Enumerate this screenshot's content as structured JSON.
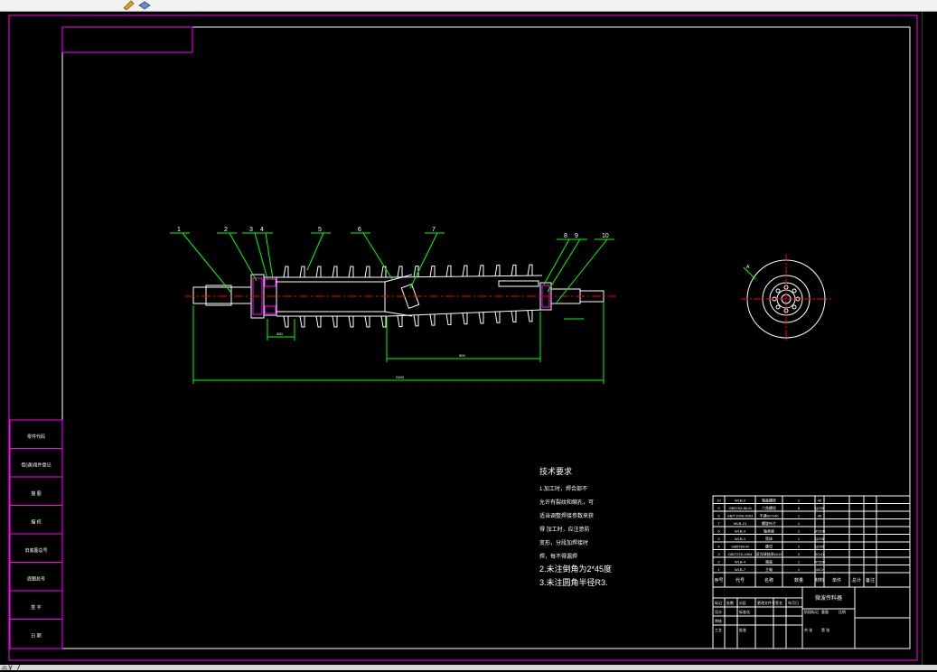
{
  "app": {
    "toolbar_icons": [
      "pencil-icon",
      "layer-icon"
    ],
    "status_text": "三ŷ /"
  },
  "colors": {
    "background": "#000000",
    "frame": "#ff00ff",
    "drawing": "#ffffff",
    "dimension": "#00ff00",
    "centerline": "#ff0000",
    "section": "#ff00ff",
    "text": "#ffffff"
  },
  "drawing": {
    "balloons": [
      "1",
      "2",
      "3",
      "4",
      "5",
      "6",
      "7",
      "8",
      "9",
      "10"
    ],
    "dimensions": [
      "360",
      "2400",
      "900"
    ],
    "section_label": "A",
    "notes_title": "技术要求",
    "notes": [
      "1.加工时，焊合部不",
      "允许有裂纹和缩孔，可",
      "适当调整焊接参数来获",
      "得 加工时，应注意防",
      "变形，分段加焊接时",
      "焊，每不得漏焊",
      "2.未注倒角为2*45度",
      "3.未注圆角半径R3."
    ]
  },
  "left_strip": [
    "零件代码",
    "借(通)用件登记",
    "描 图",
    "描 校",
    "旧底图总号",
    "底图总号",
    "签 字",
    "日 期"
  ],
  "title_block": {
    "drawing_name": "微波传料器",
    "bom_header": [
      "序号",
      "代号",
      "名称",
      "数量",
      "材料",
      "单件",
      "总计",
      "备注"
    ],
    "bom_rows": [
      [
        "10",
        "WLB-2",
        "端盖螺栓",
        "1",
        "45",
        "",
        "",
        ""
      ],
      [
        "9",
        "GB5783-86-M",
        "六角螺栓",
        "8",
        "Q235",
        "",
        "",
        ""
      ],
      [
        "8",
        "GB/T1096-2003",
        "平键8x7x40",
        "1",
        "45",
        "",
        "",
        ""
      ],
      [
        "7",
        "WLB-21",
        "螺旋叶片",
        "1",
        "",
        "",
        "",
        ""
      ],
      [
        "6",
        "WLB-3",
        "轴承座",
        "1",
        "HT200",
        "",
        "",
        ""
      ],
      [
        "5",
        "WLB-1",
        "筒体",
        "1",
        "Q235",
        "",
        "",
        ""
      ],
      [
        "4",
        "GB5783-M",
        "螺母",
        "2",
        "Q235",
        "",
        "",
        ""
      ],
      [
        "3",
        "GB/T276-1994",
        "深沟球轴承6210",
        "2",
        "GCr15",
        "",
        "",
        ""
      ],
      [
        "2",
        "WLB-4",
        "端盖",
        "1",
        "HT150",
        "",
        "",
        ""
      ],
      [
        "1",
        "WLB-7",
        "主轴",
        "1",
        "40Cr",
        "",
        "",
        ""
      ]
    ],
    "sign_row_1": [
      "标记",
      "处数",
      "分区",
      "更改文件号",
      "签名",
      "年月日"
    ],
    "sign_row_2": [
      "设计",
      "",
      "标准化",
      "",
      "阶段标记",
      "重量",
      "比例"
    ],
    "sign_row_3": [
      "审核",
      "",
      "",
      "",
      "",
      "",
      ""
    ],
    "sign_row_4": [
      "工艺",
      "",
      "批准",
      "",
      "共 张",
      "第 张"
    ]
  }
}
